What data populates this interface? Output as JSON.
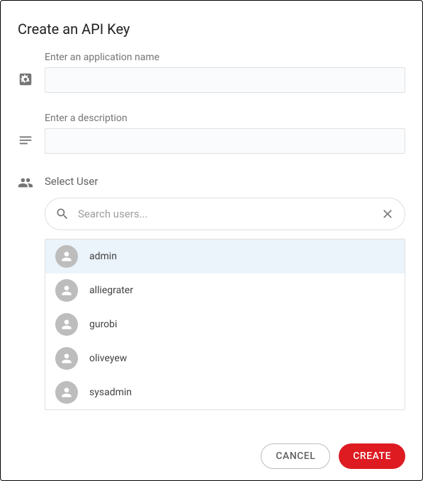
{
  "dialog": {
    "title": "Create an API Key"
  },
  "appName": {
    "label": "Enter an application name",
    "value": ""
  },
  "description": {
    "label": "Enter a description",
    "value": ""
  },
  "selectUser": {
    "label": "Select User",
    "search": {
      "placeholder": "Search users...",
      "value": ""
    },
    "users": [
      {
        "name": "admin",
        "selected": true
      },
      {
        "name": "alliegrater",
        "selected": false
      },
      {
        "name": "gurobi",
        "selected": false
      },
      {
        "name": "oliveyew",
        "selected": false
      },
      {
        "name": "sysadmin",
        "selected": false
      }
    ]
  },
  "actions": {
    "cancel": "CANCEL",
    "create": "CREATE"
  }
}
